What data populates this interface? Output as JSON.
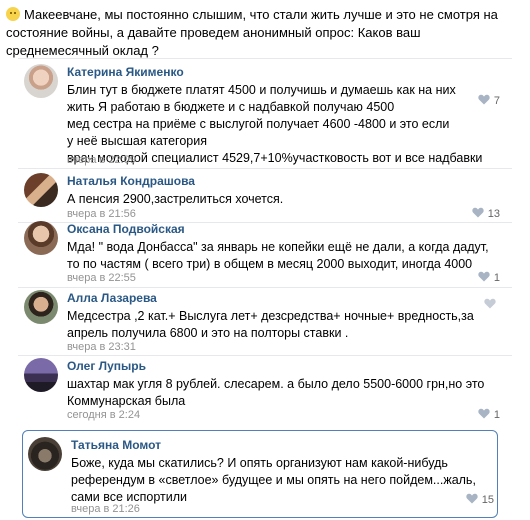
{
  "post": {
    "text": "Макеевчане, мы постоянно слышим, что стали жить лучше и это не смотря на состояние войны, а давайте проведем анонимный опрос: Каков ваш среднемесячный оклад ?"
  },
  "comments": [
    {
      "author": "Катерина Якименко",
      "lines": [
        "Блин тут в бюджете платят 4500 и получишь и думаешь как на них",
        "жить  Я работаю в бюджете и с надбавкой получаю 4500",
        "мед сестра на приёме с выслугой получает 4600 -4800 и это если",
        "у неё высшая категория",
        "врач молодой специалист 4529,7+10%участковость вот и все  надбавки"
      ],
      "time": "вчера в 22:09",
      "likes": "7"
    },
    {
      "author": "Наталья Кондрашова",
      "lines": [
        "А пенсия 2900,застрелиться хочется."
      ],
      "time": "вчера в 21:56",
      "likes": "13"
    },
    {
      "author": "Оксана Подвойская",
      "lines": [
        "Мда! \" вода Донбасса\" за январь не копейки ещё не дали, а когда дадут,",
        "то по частям ( всего три) в общем в месяц 2000 выходит, иногда 4000"
      ],
      "time": "вчера в 22:55",
      "likes": "1"
    },
    {
      "author": "Алла Лазарева",
      "lines": [
        "Медсестра ,2 кат.+ Выслуга лет+ дезсредства+ ночные+ вредность,за",
        "апрель получила 6800 и это на полторы ставки ."
      ],
      "time": "вчера в 23:31",
      "likes": ""
    },
    {
      "author": "Олег Лупырь",
      "lines": [
        "шахтар мак угля 8 рублей. слесарем. а было дело 5500-6000 грн,но это",
        "Коммунарская была"
      ],
      "time": "сегодня в 2:24",
      "likes": "1"
    },
    {
      "author": "Татьяна Момот",
      "lines": [
        "Боже, куда мы скатились? И опять организуют нам какой-нибудь",
        "референдум в «светлое» будущее и мы опять на него пойдем...жаль,",
        "сами все испортили"
      ],
      "time": "вчера в 21:26",
      "likes": "15"
    }
  ],
  "colors": {
    "link": "#2a5885",
    "meta": "#939393",
    "highlight_border": "#5181b8"
  },
  "icons": {
    "like": "heart-icon",
    "emoji": "smile-emoji-icon"
  }
}
